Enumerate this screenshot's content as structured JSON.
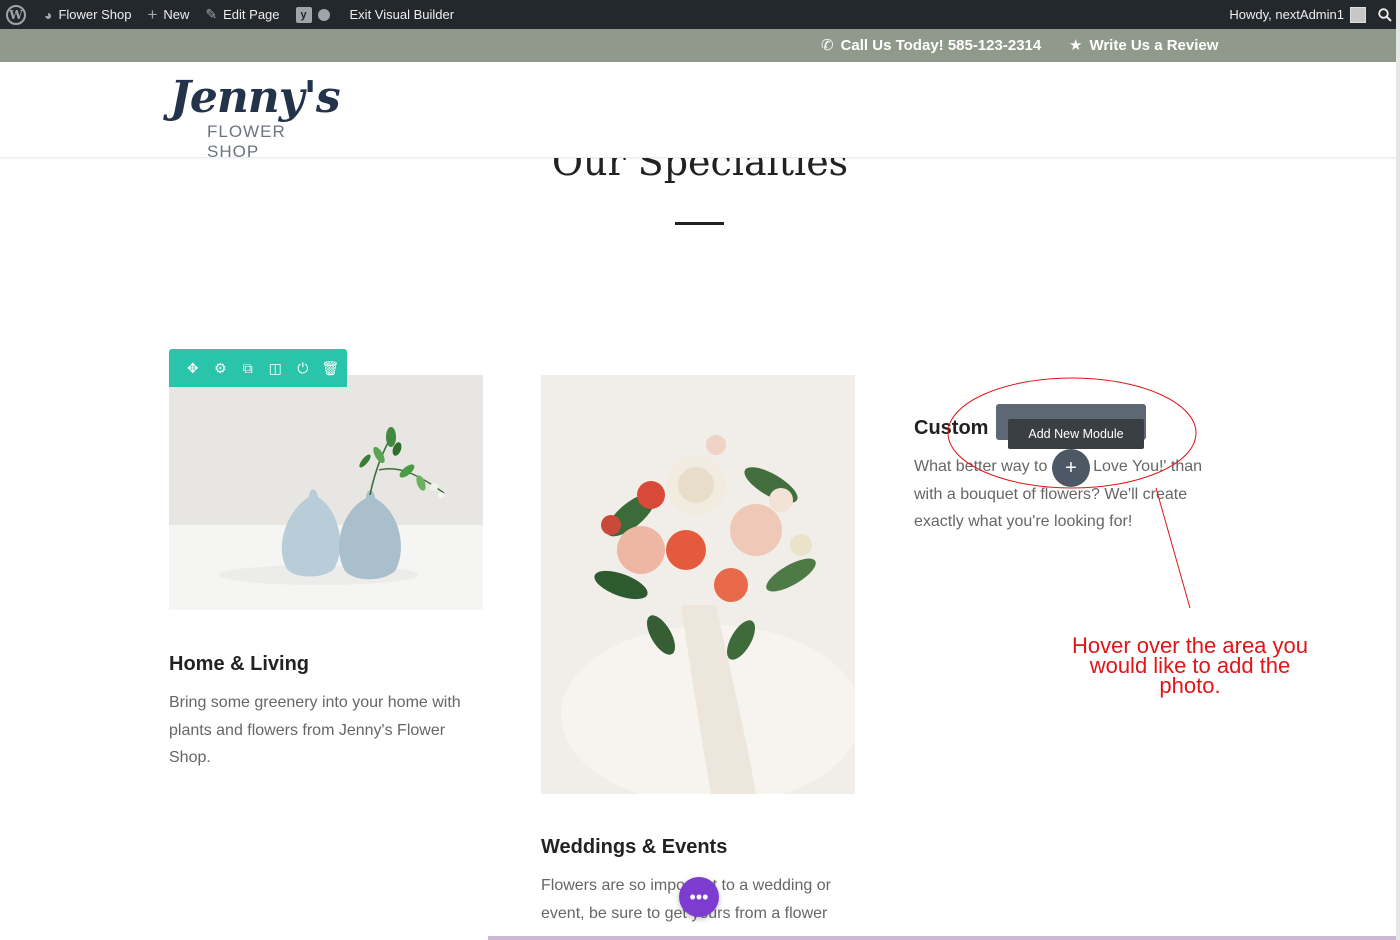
{
  "admin_bar": {
    "wp_logo": "W",
    "site_name": "Flower Shop",
    "new_label": "New",
    "edit_label": "Edit Page",
    "exit_label": "Exit Visual Builder",
    "howdy": "Howdy, nextAdmin1",
    "icons": {
      "site": "dashboard-icon",
      "new": "plus-icon",
      "edit": "pencil-icon",
      "yoast": "yoast-icon",
      "status": "status-dot-icon",
      "search": "search-icon"
    }
  },
  "top_bar": {
    "phone": "Call Us Today! 585-123-2314",
    "review": "Write Us a Review",
    "background": "#8f9a8c"
  },
  "logo": {
    "script": "Jenny's",
    "subtitle": "FLOWER SHOP"
  },
  "section": {
    "title": "Our Specialties"
  },
  "builder": {
    "row_toolbar": [
      "move-icon",
      "settings-icon",
      "duplicate-icon",
      "columns-icon",
      "save-icon",
      "delete-icon"
    ],
    "tooltip": "Add New Module",
    "add_button": "+",
    "accent": "#29c4a9",
    "fab_color": "#7e3bd0"
  },
  "cards": [
    {
      "title": "Home & Living",
      "text": "Bring some greenery into your home with plants and flowers from Jenny's Flower Shop."
    },
    {
      "title": "Weddings & Events",
      "text": "Flowers are so important to a wedding or event, be sure to get yours from a flower"
    },
    {
      "title": "Custom Bouquets",
      "title_visible": "Custom",
      "text": "What better way to say 'I Love You!' than with a bouquet of flowers? We'll create exactly what you're looking for!"
    }
  ],
  "annotation": {
    "text": "Hover over the area you would like to add the photo.",
    "color": "#e01515"
  }
}
